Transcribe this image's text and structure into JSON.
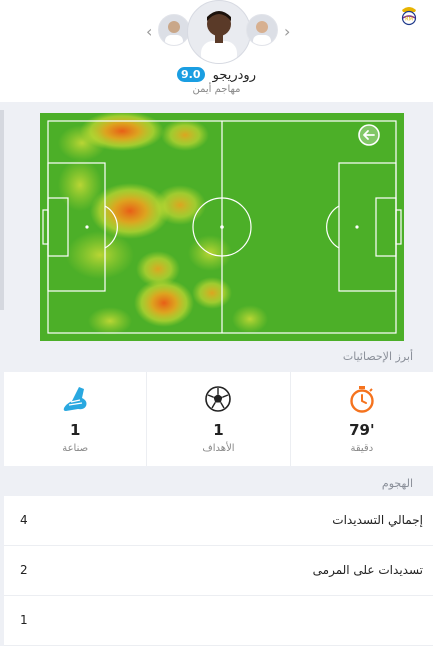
{
  "header": {
    "player_name": "رودريجو",
    "rating": "9.0",
    "position": "مهاجم أيمن",
    "prev_icon": "chevron-left-icon",
    "next_icon": "chevron-right-icon",
    "club_logo_icon": "real-madrid-crest-icon"
  },
  "heatmap": {
    "back_icon": "arrow-left-circle-icon",
    "pitch_color": "#4caf28",
    "line_color": "#ffffff"
  },
  "highlights": {
    "title": "أبرز الإحصائيات",
    "items": [
      {
        "value": "1",
        "label": "صناعة",
        "icon": "football-boot-icon"
      },
      {
        "value": "1",
        "label": "الأهداف",
        "icon": "football-ball-icon"
      },
      {
        "value": "79'",
        "label": "دقيقة",
        "icon": "stopwatch-icon"
      }
    ]
  },
  "attack": {
    "title": "الهجوم",
    "rows": [
      {
        "label": "إجمالي التسديدات",
        "value": "4"
      },
      {
        "label": "تسديدات على المرمى",
        "value": "2"
      },
      {
        "label": "",
        "value": "1"
      }
    ]
  },
  "colors": {
    "accent": "#1a9ee2",
    "stopwatch": "#f5731e",
    "boot": "#29a8e0"
  }
}
